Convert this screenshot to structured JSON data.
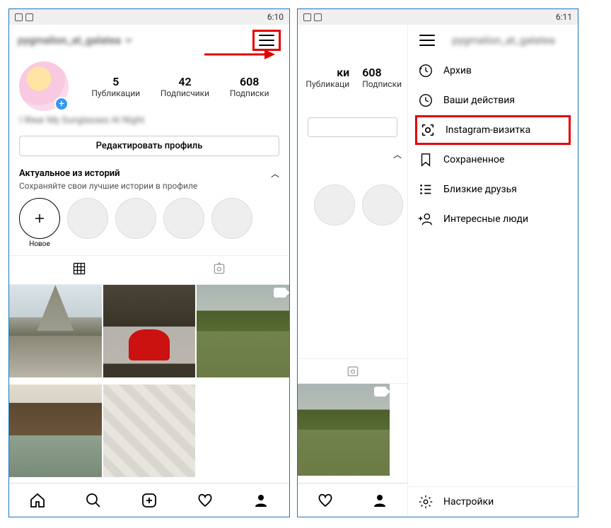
{
  "status": {
    "time_left": "6:10",
    "time_right": "6:11"
  },
  "profile": {
    "username_masked": "pygmalion_at_galatea",
    "bio_masked": "I Wear My Sunglasses At Night",
    "stats": {
      "posts_count": "5",
      "posts_label": "Публикации",
      "followers_count": "42",
      "followers_label": "Подписчики",
      "following_count": "608",
      "following_label": "Подписки"
    },
    "edit_button": "Редактировать профиль",
    "highlights_title": "Актуальное из историй",
    "highlights_sub": "Сохраняйте свои лучшие истории в профиле",
    "highlight_new_label": "Новое"
  },
  "slivers": {
    "posts_count_cut": "ки",
    "posts_label_cut": "Публикаци",
    "following_count": "608",
    "following_label": "Подписки"
  },
  "menu": {
    "archive": "Архив",
    "activity": "Ваши действия",
    "nametag": "Instagram-визитка",
    "saved": "Сохраненное",
    "close_friends": "Близкие друзья",
    "discover": "Интересные люди",
    "settings": "Настройки"
  },
  "annotation": {
    "highlight_color": "#e30000"
  }
}
